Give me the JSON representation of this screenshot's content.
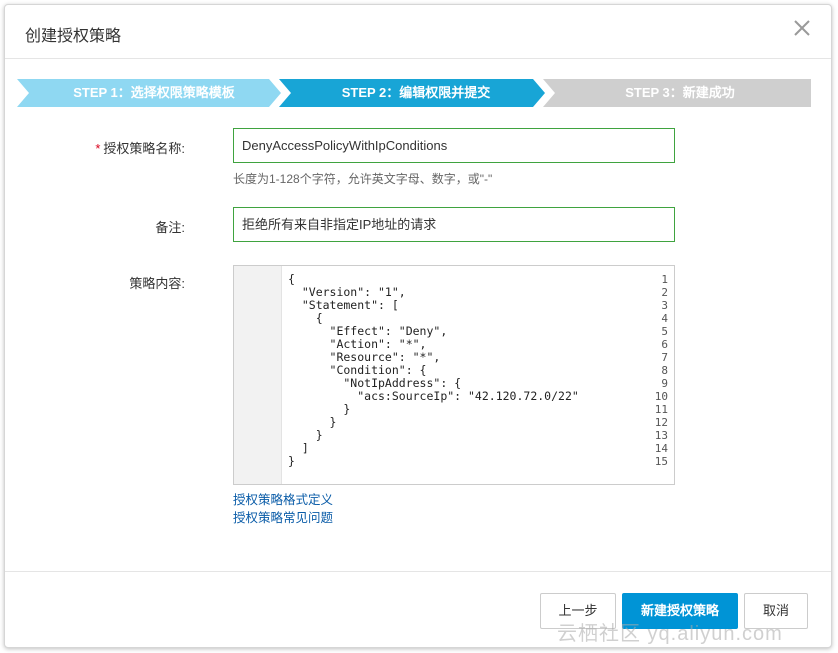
{
  "dialog": {
    "title": "创建授权策略"
  },
  "steps": [
    {
      "label": "STEP 1：选择权限策略模板",
      "state": "done"
    },
    {
      "label": "STEP 2：编辑权限并提交",
      "state": "active"
    },
    {
      "label": "STEP 3：新建成功",
      "state": "pending"
    }
  ],
  "colors": {
    "step_done": "#8fd8f2",
    "step_active": "#18a5d6",
    "step_pending": "#cfcfcf",
    "primary": "#0094d6",
    "input_border": "#3fa33f",
    "link": "#0a5ca8"
  },
  "form": {
    "name_label": "授权策略名称:",
    "required_mark": "*",
    "name_value": "DenyAccessPolicyWithIpConditions",
    "name_hint": "长度为1-128个字符，允许英文字母、数字，或\"-\"",
    "note_label": "备注:",
    "note_value": "拒绝所有来自非指定IP地址的请求",
    "content_label": "策略内容:"
  },
  "editor": {
    "lines": [
      {
        "n": "1",
        "text": "{"
      },
      {
        "n": "2",
        "text": "  \"Version\": \"1\","
      },
      {
        "n": "3",
        "text": "  \"Statement\": ["
      },
      {
        "n": "4",
        "text": "    {"
      },
      {
        "n": "5",
        "text": "      \"Effect\": \"Deny\","
      },
      {
        "n": "6",
        "text": "      \"Action\": \"*\","
      },
      {
        "n": "7",
        "text": "      \"Resource\": \"*\","
      },
      {
        "n": "8",
        "text": "      \"Condition\": {"
      },
      {
        "n": "9",
        "text": "        \"NotIpAddress\": {"
      },
      {
        "n": "10",
        "text": "          \"acs:SourceIp\": \"42.120.72.0/22\""
      },
      {
        "n": "11",
        "text": "        }"
      },
      {
        "n": "12",
        "text": "      }"
      },
      {
        "n": "13",
        "text": "    }"
      },
      {
        "n": "14",
        "text": "  ]"
      },
      {
        "n": "15",
        "text": "}"
      }
    ]
  },
  "links": {
    "format_def": "授权策略格式定义",
    "faq": "授权策略常见问题"
  },
  "buttons": {
    "prev": "上一步",
    "create": "新建授权策略",
    "cancel": "取消"
  },
  "watermark": "云栖社区 yq.aliyun.com",
  "icons": {
    "close": "close-icon"
  }
}
